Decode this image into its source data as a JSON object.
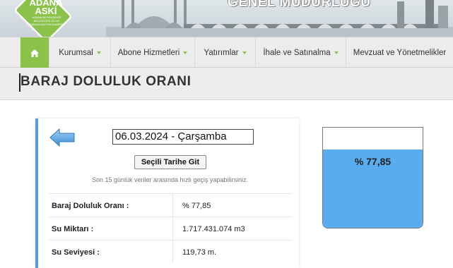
{
  "header": {
    "logo_text": "ADANA\nASKİ",
    "logo_subtext": "ADANA BÜYÜKŞEHİR BELEDİYESİ SU VE KANALİZASYON İDARESİ",
    "directorate_text": "GENEL MÜDÜRLÜĞÜ"
  },
  "nav": {
    "home_icon": "home-icon",
    "items": [
      {
        "label": "Kurumsal"
      },
      {
        "label": "Abone Hizmetleri"
      },
      {
        "label": "Yatırımlar"
      },
      {
        "label": "İhale ve Satınalma"
      },
      {
        "label": "Mevzuat ve Yönetmelikler"
      }
    ]
  },
  "page": {
    "title": "BARAJ DOLULUK ORANI"
  },
  "panel": {
    "date_value": "06.03.2024 - Çarşamba",
    "goto_button": "Seçili Tarihe Git",
    "hint": "Son 15 günlük veriler arasında hızlı geçiş yapabilirsiniz.",
    "rows": [
      {
        "label": "Baraj Doluluk Oranı :",
        "value": "% 77,85"
      },
      {
        "label": "Su Miktarı :",
        "value": "1.717.431.074 m3"
      },
      {
        "label": "Su Seviyesi :",
        "value": "119,73 m."
      }
    ]
  },
  "gauge": {
    "label": "% 77,85",
    "fill_percent": 77.85,
    "fill_color": "#5aacf0"
  },
  "colors": {
    "accent_green": "#8bc34a",
    "panel_border_blue": "#5b9bd5"
  }
}
